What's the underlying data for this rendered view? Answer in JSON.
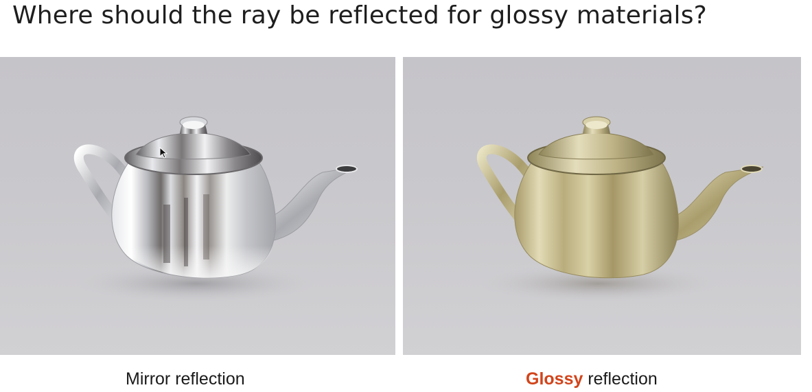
{
  "slide": {
    "title": "Where should the ray be reflected for glossy materials?",
    "panels": [
      {
        "caption": "Mirror reflection"
      },
      {
        "caption_highlight": "Glossy",
        "caption_rest": " reflection"
      }
    ]
  },
  "colors": {
    "accent": "#d2441b",
    "background": "#c8c7cb",
    "mirror_metal": "#d9dadd",
    "gold_metal": "#c2b88a"
  },
  "icons": {
    "cursor": "mouse-pointer-icon"
  }
}
